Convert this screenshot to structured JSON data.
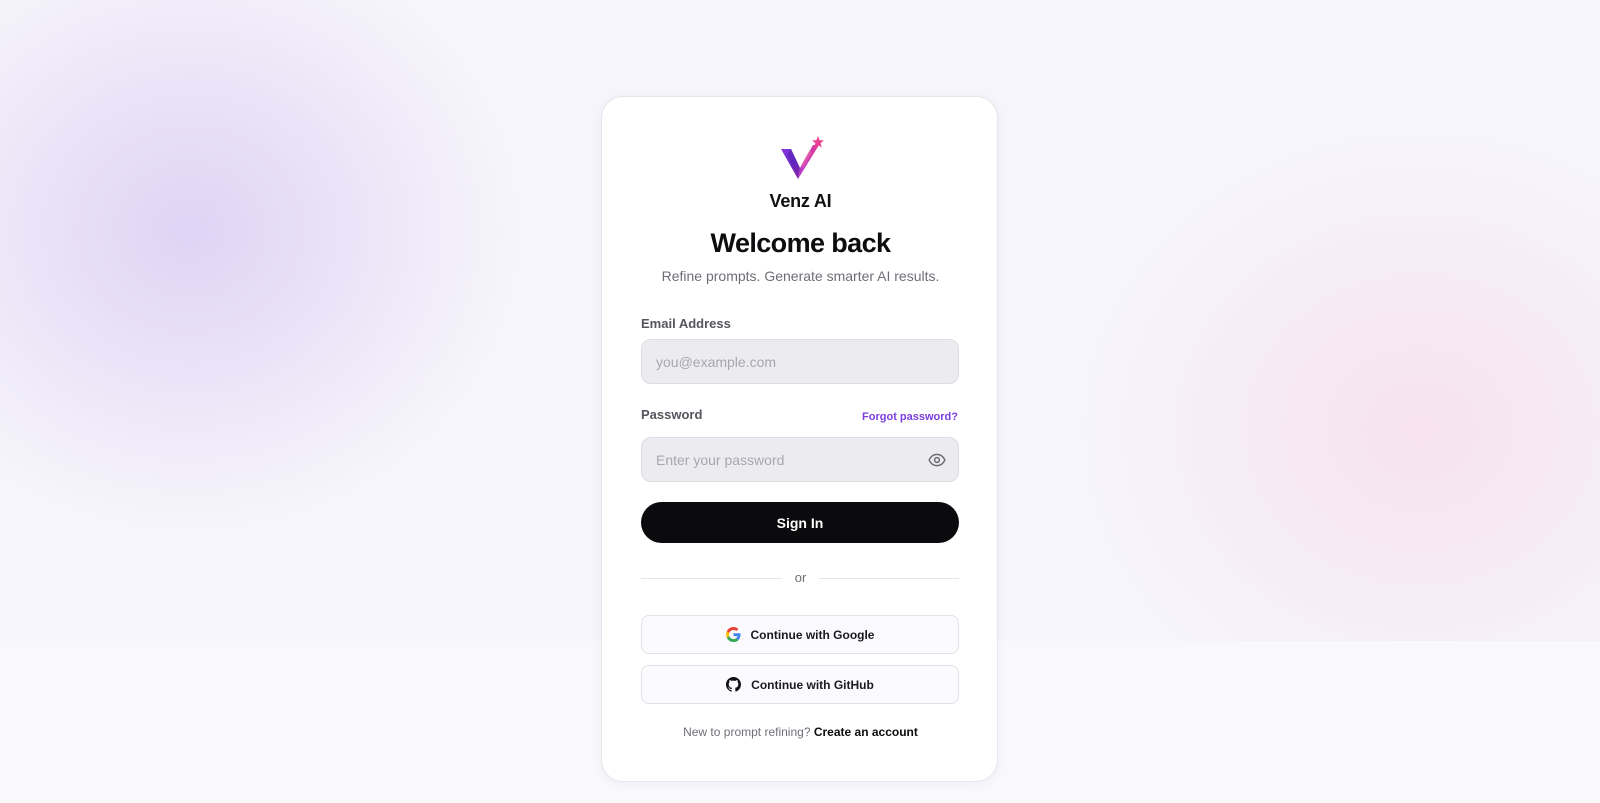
{
  "brand": {
    "name": "Venz AI",
    "logo_icon": "venz-v-star-logo",
    "logo_colors": [
      "#7b2fd6",
      "#c02fa8",
      "#e23a8f"
    ]
  },
  "header": {
    "title": "Welcome back",
    "subtitle": "Refine prompts. Generate smarter AI results."
  },
  "form": {
    "email": {
      "label": "Email Address",
      "placeholder": "you@example.com",
      "value": ""
    },
    "password": {
      "label": "Password",
      "placeholder": "Enter your password",
      "value": "",
      "toggle_icon": "eye-icon"
    },
    "forgot_link": "Forgot password?",
    "submit_label": "Sign In"
  },
  "divider": {
    "text": "or"
  },
  "oauth": {
    "google": {
      "label": "Continue with Google",
      "icon": "google-icon"
    },
    "github": {
      "label": "Continue with GitHub",
      "icon": "github-icon"
    }
  },
  "footer": {
    "prompt": "New to prompt refining?",
    "link": "Create an account"
  },
  "colors": {
    "accent": "#7a3fe0",
    "primary_button": "#0b0b0d",
    "input_bg": "#ececf0"
  }
}
